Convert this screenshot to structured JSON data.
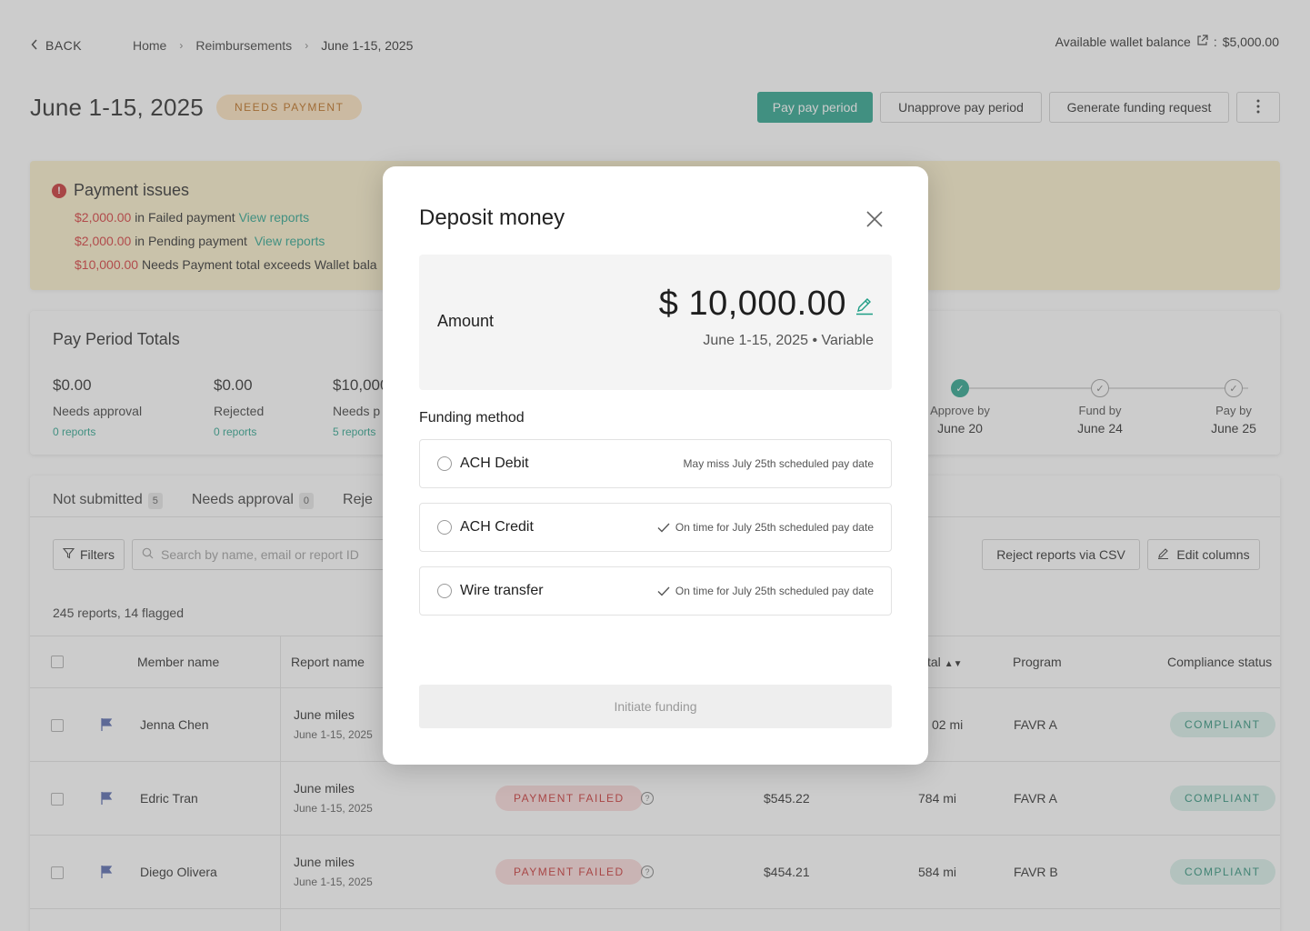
{
  "nav": {
    "back_label": "BACK",
    "breadcrumbs": [
      "Home",
      "Reimbursements",
      "June 1-15, 2025"
    ],
    "wallet_label": "Available wallet balance",
    "wallet_value": "$5,000.00"
  },
  "header": {
    "title": "June 1-15, 2025",
    "status": "NEEDS PAYMENT",
    "actions": {
      "pay": "Pay pay period",
      "unapprove": "Unapprove pay period",
      "funding": "Generate funding request"
    }
  },
  "alert": {
    "title": "Payment issues",
    "lines": [
      {
        "amount": "$2,000.00",
        "text": "in Failed payment",
        "link": "View reports"
      },
      {
        "amount": "$2,000.00",
        "text": "in Pending payment",
        "link": "View reports"
      },
      {
        "amount": "$10,000.00",
        "text": "Needs Payment total exceeds Wallet bala"
      }
    ]
  },
  "totals": {
    "title": "Pay Period Totals",
    "stats": [
      {
        "value": "$0.00",
        "label": "Needs approval",
        "reports": "0 reports"
      },
      {
        "value": "$0.00",
        "label": "Rejected",
        "reports": "0 reports"
      },
      {
        "value": "$10,000",
        "label": "Needs p",
        "reports": "5 reports"
      }
    ],
    "timeline": [
      {
        "label": "Approve by",
        "date": "June 20"
      },
      {
        "label": "Fund by",
        "date": "June 24"
      },
      {
        "label": "Pay by",
        "date": "June 25"
      }
    ]
  },
  "reports": {
    "tabs": [
      {
        "label": "Not submitted",
        "count": "5"
      },
      {
        "label": "Needs approval",
        "count": "0"
      },
      {
        "label": "Reje",
        "count": ""
      }
    ],
    "filters_label": "Filters",
    "search_placeholder": "Search by name, email or report ID",
    "reject_csv_label": "Reject reports via CSV",
    "edit_columns_label": "Edit columns",
    "count_text": "245 reports, 14 flagged",
    "columns": {
      "member": "Member name",
      "report": "Report name",
      "total": "tal",
      "program": "Program",
      "compliance": "Compliance status"
    },
    "rows": [
      {
        "member": "Jenna Chen",
        "report": "June miles",
        "period": "June 1-15, 2025",
        "status": "",
        "amount": "",
        "distance": "02 mi",
        "program": "FAVR A",
        "compliance": "COMPLIANT"
      },
      {
        "member": "Edric Tran",
        "report": "June miles",
        "period": "June 1-15, 2025",
        "status": "PAYMENT FAILED",
        "amount": "$545.22",
        "distance": "784 mi",
        "program": "FAVR A",
        "compliance": "COMPLIANT"
      },
      {
        "member": "Diego Olivera",
        "report": "June miles",
        "period": "June 1-15, 2025",
        "status": "PAYMENT FAILED",
        "amount": "$454.21",
        "distance": "584 mi",
        "program": "FAVR B",
        "compliance": "COMPLIANT"
      }
    ]
  },
  "modal": {
    "title": "Deposit money",
    "amount_label": "Amount",
    "amount_value": "$ 10,000.00",
    "amount_meta": "June 1-15, 2025 • Variable",
    "funding_method_label": "Funding method",
    "options": [
      {
        "name": "ACH Debit",
        "note": "May miss July 25th scheduled pay date",
        "on_time": false
      },
      {
        "name": "ACH Credit",
        "note": "On time for July 25th scheduled pay date",
        "on_time": true
      },
      {
        "name": "Wire transfer",
        "note": "On time for July 25th scheduled pay date",
        "on_time": true
      }
    ],
    "initiate_label": "Initiate funding"
  },
  "colors": {
    "accent": "#1f9e86",
    "error": "#d32f2f",
    "warning_bg": "#fbefc9"
  }
}
